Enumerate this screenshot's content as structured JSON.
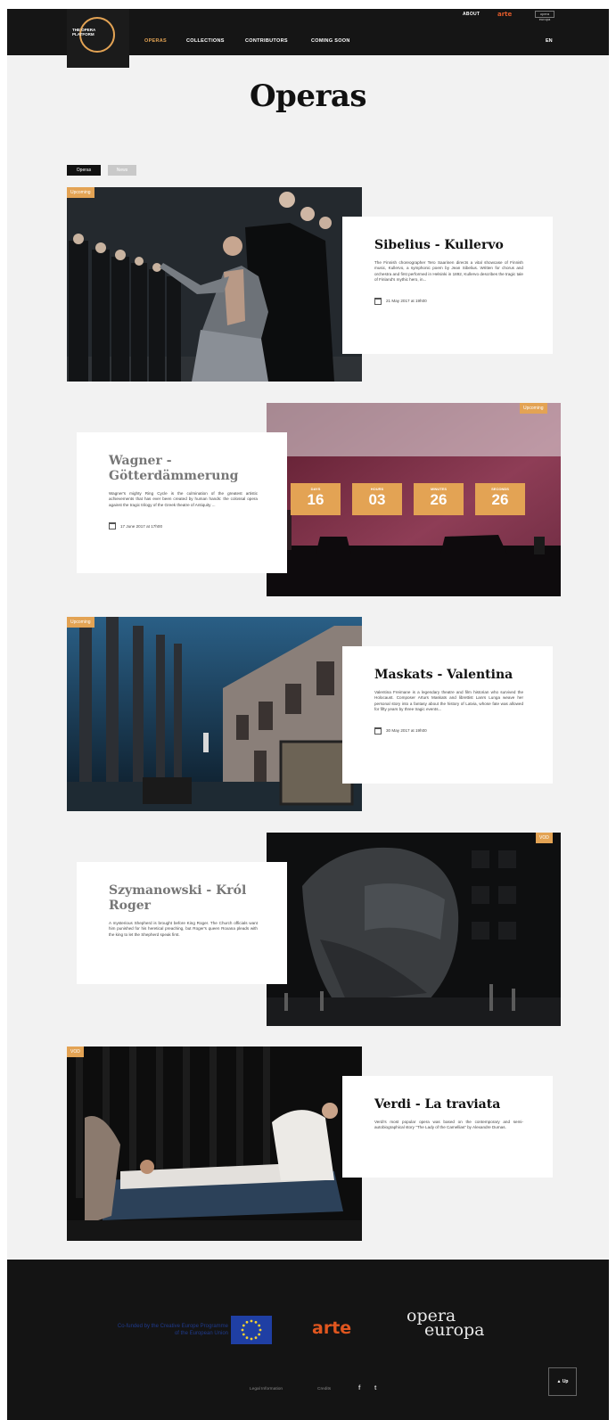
{
  "header": {
    "top_links": [
      "ABOUT",
      "arte"
    ],
    "partner_logo": "opera europa",
    "logo_text": "The Opera Platform",
    "nav": [
      "OPERAS",
      "COLLECTIONS",
      "CONTRIBUTORS",
      "COMING SOON"
    ],
    "lang": "EN"
  },
  "page": {
    "title": "Operas"
  },
  "tabs": [
    "Operas",
    "News"
  ],
  "cards": [
    {
      "status": "Upcoming",
      "title": "Sibelius - Kullervo",
      "description": "The Finnish choreographer Tero Saarinen directs a vital showcase of Finnish music, Kullervo, a symphonic poem by Jean Sibelius. Written for chorus and orchestra and first performed in Helsinki in 1892, Kullervo describes the tragic tale of Finland's mythic hero, in...",
      "date": "21 May 2017 at 19h00"
    },
    {
      "status": "Upcoming",
      "title": "Wagner - Götterdämmerung",
      "description": "Wagner's mighty Ring Cycle is the culmination of the greatest artistic achievements that has ever been created by human hands: the colossal opera against the tragic trilogy of the Greek theatre of Antiquity ...",
      "date": "17 June 2017 at 17h00",
      "countdown": [
        {
          "label": "DAYS",
          "value": "16"
        },
        {
          "label": "HOURS",
          "value": "03"
        },
        {
          "label": "MINUTES",
          "value": "26"
        },
        {
          "label": "SECONDS",
          "value": "26"
        }
      ]
    },
    {
      "status": "Upcoming",
      "title": "Maskats - Valentina",
      "description": "Valentina Freimane is a legendary theatre and film historian who survived the Holocaust. Composer Arturs Maskats and librettist Lanrs Lunga weave her personal story into a fantasy about the history of Latvia, whose fate was allowed for fifty years by three tragic events...",
      "date": "30 May 2017 at 19h00"
    },
    {
      "status": "VOD",
      "title": "Szymanowski - Król Roger",
      "description": "A mysterious Shepherd is brought before King Roger. The Church officials want him punished for his heretical preaching, but Roger's queen Roxana pleads with the king to let the Shepherd speak first."
    },
    {
      "status": "VOD",
      "title": "Verdi - La traviata",
      "description": "Verdi's most popular opera was based on the contemporary and semi-autobiographical story \"The Lady of the Camellias\" by Alexandre Dumas."
    }
  ],
  "footer": {
    "cofund_text": "Co-funded by the Creative Europe Programme of the European Union",
    "arte": "arte",
    "opera_europa": [
      "opera",
      "europa"
    ],
    "links": [
      "Legal Information",
      "Credits"
    ],
    "social": [
      "f",
      "t"
    ],
    "up_button": "▲ Up"
  },
  "colors": {
    "accent": "#e3a354",
    "dark": "#151515",
    "background": "#f2f2f2"
  }
}
